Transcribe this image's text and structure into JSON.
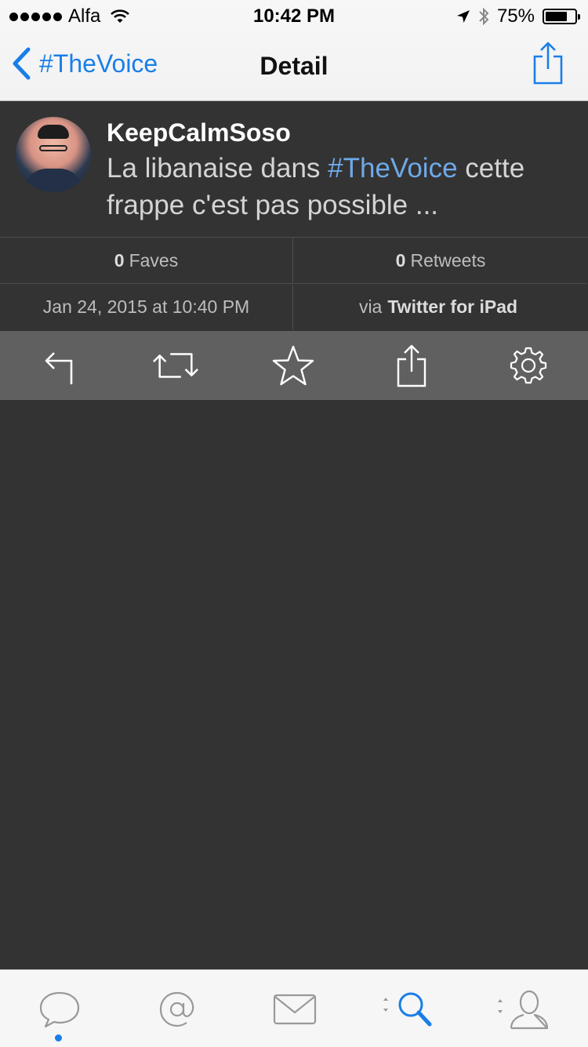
{
  "status_bar": {
    "carrier": "Alfa",
    "time": "10:42 PM",
    "battery": "75%",
    "battery_level": 0.75
  },
  "nav": {
    "back_label": "#TheVoice",
    "title": "Detail"
  },
  "tweet": {
    "username": "KeepCalmSoso",
    "text_before": "La libanaise dans ",
    "hashtag": "#TheVoice",
    "text_after": " cette frappe c'est pas possible ..."
  },
  "stats": {
    "faves_count": "0",
    "faves_label": "Faves",
    "retweets_count": "0",
    "retweets_label": "Retweets",
    "timestamp": "Jan 24, 2015 at 10:40 PM",
    "via_prefix": "via",
    "client": "Twitter for iPad"
  },
  "actions": [
    "reply-icon",
    "retweet-icon",
    "star-icon",
    "share-icon",
    "gear-icon"
  ],
  "tabs": [
    "timeline-icon",
    "mentions-icon",
    "messages-icon",
    "search-icon",
    "profile-icon"
  ],
  "colors": {
    "accent": "#1a7ee8",
    "hashtag": "#6fa9e8",
    "background": "#333333",
    "toolbar": "#606060"
  }
}
